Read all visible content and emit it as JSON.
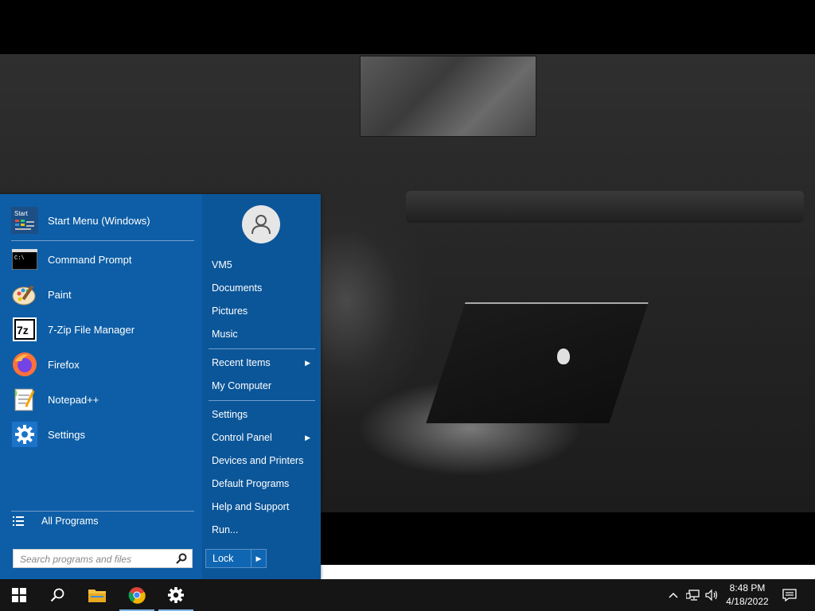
{
  "start_menu": {
    "pinned": [
      {
        "label": "Start Menu (Windows)",
        "icon": "start-menu-icon"
      }
    ],
    "programs": [
      {
        "label": "Command Prompt",
        "icon": "command-prompt-icon"
      },
      {
        "label": "Paint",
        "icon": "paint-icon"
      },
      {
        "label": "7-Zip File Manager",
        "icon": "7zip-icon"
      },
      {
        "label": "Firefox",
        "icon": "firefox-icon"
      },
      {
        "label": "Notepad++",
        "icon": "notepadpp-icon"
      },
      {
        "label": "Settings",
        "icon": "settings-icon"
      }
    ],
    "start_icon_text": "Start",
    "cmd_icon_text": "C:\\",
    "zip_icon_text": "7z",
    "all_programs": "All Programs",
    "search_placeholder": "Search programs and files",
    "right": {
      "user": "VM5",
      "documents": "Documents",
      "pictures": "Pictures",
      "music": "Music",
      "recent_items": "Recent Items",
      "my_computer": "My Computer",
      "settings": "Settings",
      "control_panel": "Control Panel",
      "devices_printers": "Devices and Printers",
      "default_programs": "Default Programs",
      "help_support": "Help and Support",
      "run": "Run..."
    },
    "lock": "Lock",
    "accent": "#0d5ea6"
  },
  "taskbar": {
    "apps": [
      "windows-start-icon",
      "search-icon",
      "file-explorer-icon",
      "chrome-icon",
      "settings-gear-icon"
    ],
    "time": "8:48 PM",
    "date": "4/18/2022"
  }
}
